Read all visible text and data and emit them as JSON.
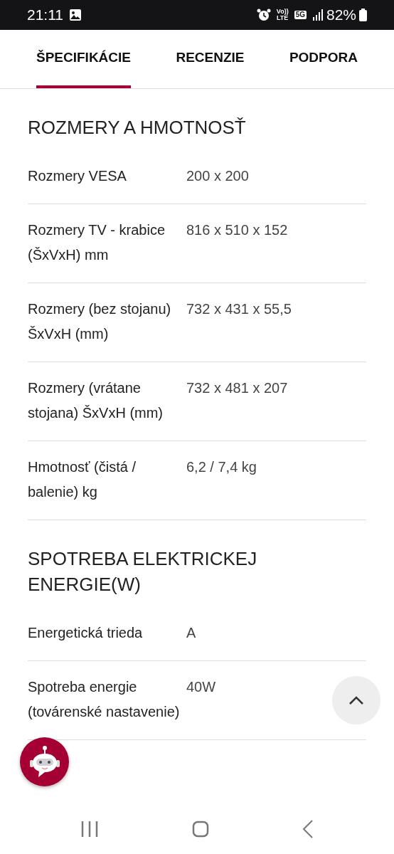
{
  "status_bar": {
    "time": "21:11",
    "volte": {
      "top": "Vo))",
      "bottom": "LTE"
    },
    "network": "5G",
    "battery": "82%"
  },
  "tabs": [
    {
      "label": "ŠPECIFIKÁCIE",
      "selected": true
    },
    {
      "label": "RECENZIE",
      "selected": false
    },
    {
      "label": "PODPORA",
      "selected": false
    }
  ],
  "sections": [
    {
      "title": "ROZMERY A HMOTNOSŤ",
      "rows": [
        {
          "label": "Rozmery VESA",
          "value": "200 x 200"
        },
        {
          "label": "Rozmery TV - krabice (ŠxVxH) mm",
          "value": "816 x 510 x 152"
        },
        {
          "label": "Rozmery (bez stojanu) ŠxVxH (mm)",
          "value": "732 x 431 x 55,5"
        },
        {
          "label": "Rozmery (vrátane stojana) ŠxVxH (mm)",
          "value": "732 x 481 x 207"
        },
        {
          "label": "Hmotnosť (čistá / balenie) kg",
          "value": "6,2 / 7,4 kg"
        }
      ]
    },
    {
      "title": "SPOTREBA ELEKTRICKEJ ENERGIE(W)",
      "rows": [
        {
          "label": "Energetická trieda",
          "value": "A"
        },
        {
          "label": "Spotreba energie (továrenské nastavenie)",
          "value": "40W"
        }
      ]
    }
  ]
}
